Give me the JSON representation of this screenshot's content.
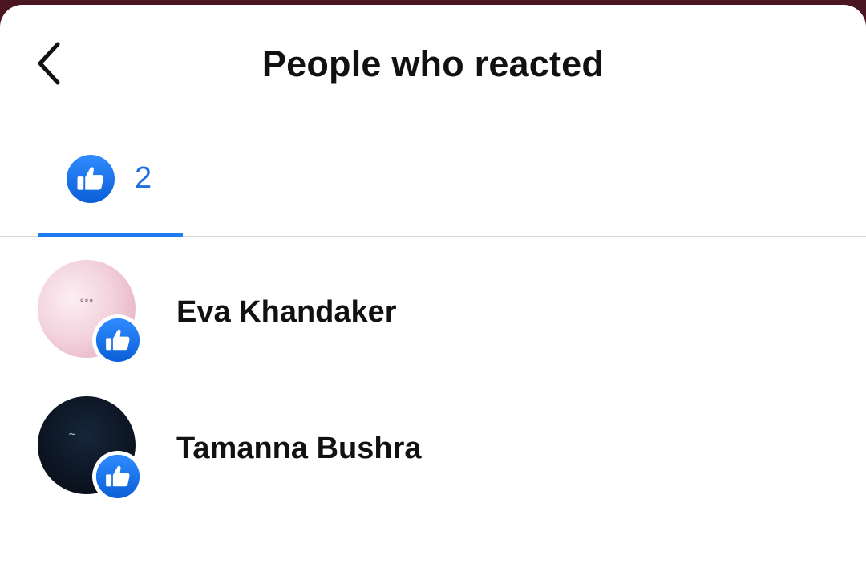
{
  "header": {
    "title": "People who reacted",
    "back_icon": "chevron-left-icon"
  },
  "tabs": [
    {
      "icon": "like-icon",
      "count": "2",
      "selected": true
    }
  ],
  "reactions": [
    {
      "name": "Eva Khandaker",
      "reaction_icon": "like-icon"
    },
    {
      "name": "Tamanna Bushra",
      "reaction_icon": "like-icon"
    }
  ],
  "colors": {
    "accent": "#1e7bf0",
    "like_blue": "#1877f2",
    "title_text": "#111111",
    "backdrop": "#4a1622"
  }
}
